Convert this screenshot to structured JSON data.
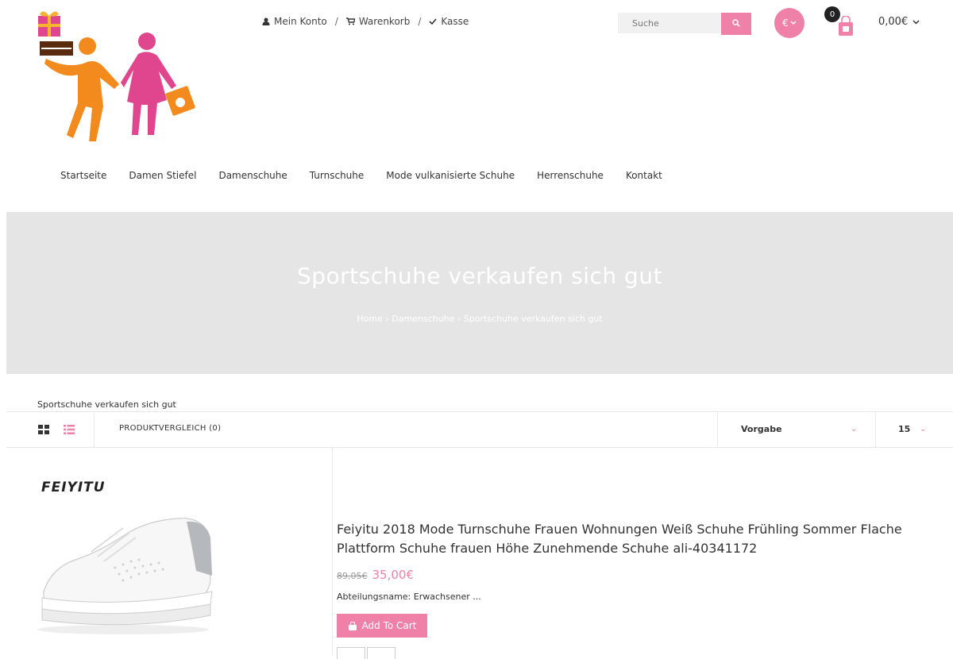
{
  "header": {
    "account_label": "Mein Konto",
    "cart_label": "Warenkorb",
    "checkout_label": "Kasse",
    "separator": "/",
    "search_placeholder": "Suche",
    "currency_symbol": "€",
    "cart_count": "0",
    "cart_total": "0,00€"
  },
  "nav": {
    "items": [
      "Startseite",
      "Damen Stiefel",
      "Damenschuhe",
      "Turnschuhe",
      "Mode vulkanisierte Schuhe",
      "Herrenschuhe",
      "Kontakt"
    ]
  },
  "banner": {
    "title": "Sportschuhe verkaufen sich gut",
    "breadcrumb": "Home › Damenschuhe › Sportschuhe verkaufen sich gut"
  },
  "page_label": "Sportschuhe verkaufen sich gut",
  "toolbar": {
    "compare_label": "PRODUKTVERGLEICH (0)",
    "sort_value": "Vorgabe",
    "limit_value": "15"
  },
  "product": {
    "brand": "FEIYITU",
    "title": "Feiyitu 2018 Mode Turnschuhe Frauen Wohnungen Weiß Schuhe Frühling Sommer Flache Plattform Schuhe frauen Höhe Zunehmende Schuhe ali-40341172",
    "old_price": "89,05€",
    "new_price": "35,00€",
    "attribute": "Abteilungsname: Erwachsener ...",
    "add_to_cart_label": "Add To Cart"
  },
  "colors": {
    "accent": "#ef80a8",
    "banner_bg": "#e5e5e5"
  }
}
